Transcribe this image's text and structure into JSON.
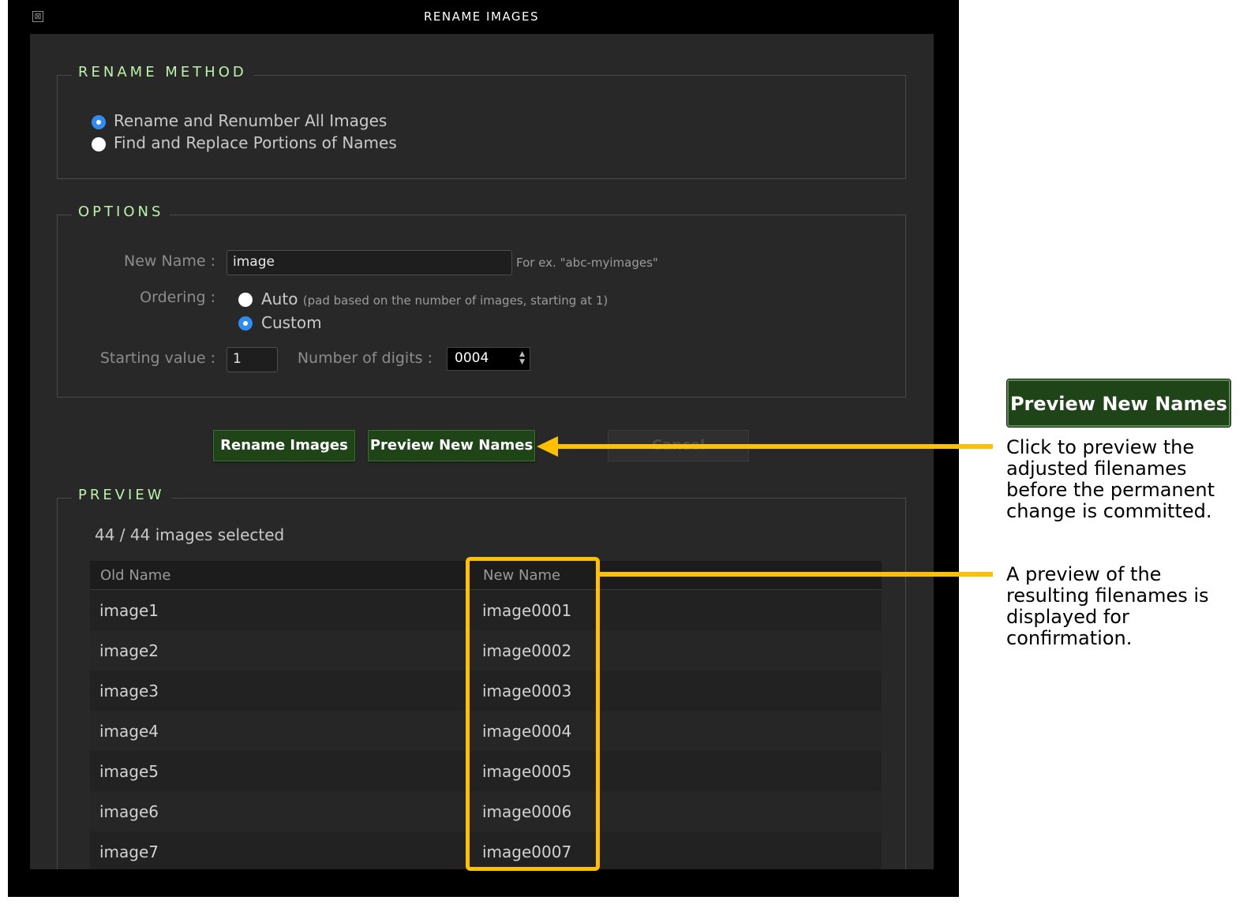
{
  "window": {
    "title": "RENAME IMAGES",
    "close_glyph": "⊠"
  },
  "rename_method": {
    "legend": "RENAME METHOD",
    "options": [
      {
        "label": "Rename and Renumber All Images",
        "selected": true
      },
      {
        "label": "Find and Replace Portions of Names",
        "selected": false
      }
    ]
  },
  "options": {
    "legend": "OPTIONS",
    "new_name_label": "New Name :",
    "new_name_value": "image",
    "new_name_hint": "For ex. \"abc-myimages\"",
    "ordering_label": "Ordering :",
    "ordering_auto": "Auto",
    "ordering_auto_hint": "(pad based on the number of images, starting at 1)",
    "ordering_custom": "Custom",
    "starting_value_label": "Starting value :",
    "starting_value": "1",
    "digits_label": "Number of digits :",
    "digits_value": "0004"
  },
  "buttons": {
    "rename": "Rename Images",
    "preview": "Preview New Names",
    "cancel": "Cancel"
  },
  "preview": {
    "legend": "PREVIEW",
    "selection_count": "44 / 44 images selected",
    "columns": {
      "old": "Old Name",
      "new": "New Name"
    },
    "rows": [
      {
        "old": "image1",
        "new": "image0001"
      },
      {
        "old": "image2",
        "new": "image0002"
      },
      {
        "old": "image3",
        "new": "image0003"
      },
      {
        "old": "image4",
        "new": "image0004"
      },
      {
        "old": "image5",
        "new": "image0005"
      },
      {
        "old": "image6",
        "new": "image0006"
      },
      {
        "old": "image7",
        "new": "image0007"
      }
    ]
  },
  "annotations": {
    "callout_button": "Preview New Names",
    "note_preview_button": "Click to preview the adjusted filenames before the permanent change is committed.",
    "note_preview_table": "A preview of the resulting filenames is displayed for confirmation.",
    "highlight_color": "#ffc000"
  },
  "colors": {
    "accent_green": "#1e4418",
    "legend_green": "#b9f4a8",
    "radio_blue": "#2f8cf0"
  }
}
